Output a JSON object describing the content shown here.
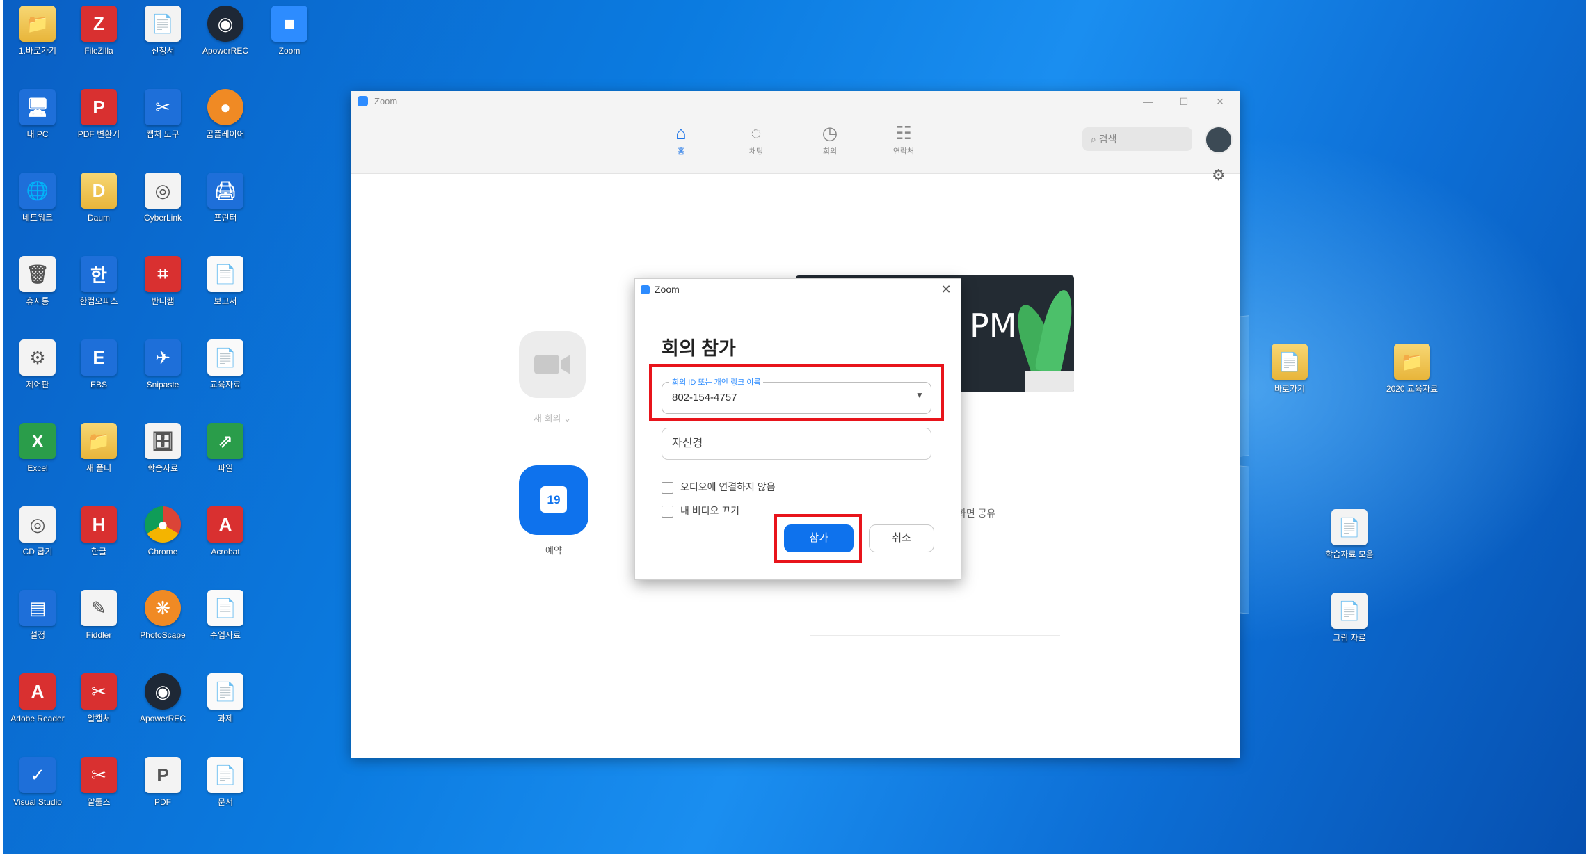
{
  "desktop": {
    "icons_left": [
      {
        "label": "1.바로가기",
        "icon": "folder-icon",
        "glyph": "📁",
        "style": "g-folder"
      },
      {
        "label": "FileZilla",
        "icon": "filezilla-icon",
        "glyph": "Z",
        "style": "g-red"
      },
      {
        "label": "신청서",
        "icon": "document-icon",
        "glyph": "📄",
        "style": "g-white"
      },
      {
        "label": "ApowerREC",
        "icon": "recorder-icon",
        "glyph": "◉",
        "style": "g-dark"
      },
      {
        "label": "Zoom",
        "icon": "zoom-icon",
        "glyph": "■",
        "style": "g-zoom"
      },
      {
        "label": "내 PC",
        "icon": "computer-icon",
        "glyph": "🖥",
        "style": "g-blue"
      },
      {
        "label": "PDF 변환기",
        "icon": "pdf-converter-icon",
        "glyph": "P",
        "style": "g-red"
      },
      {
        "label": "캡처 도구",
        "icon": "capture-icon",
        "glyph": "✂",
        "style": "g-blue"
      },
      {
        "label": "곰플레이어",
        "icon": "player-icon",
        "glyph": "●",
        "style": "g-orange"
      },
      {
        "label": "네트워크",
        "icon": "network-icon",
        "glyph": "🌐",
        "style": "g-blue"
      },
      {
        "label": "Daum",
        "icon": "daum-icon",
        "glyph": "D",
        "style": "g-folder"
      },
      {
        "label": "CyberLink",
        "icon": "disc-icon",
        "glyph": "◎",
        "style": "g-white"
      },
      {
        "label": "프린터",
        "icon": "printer-icon",
        "glyph": "🖨",
        "style": "g-blue"
      },
      {
        "label": "휴지통",
        "icon": "recycle-bin-icon",
        "glyph": "🗑",
        "style": "g-white"
      },
      {
        "label": "한컴오피스",
        "icon": "hancom-icon",
        "glyph": "한",
        "style": "g-blue"
      },
      {
        "label": "반디캠",
        "icon": "crop-icon",
        "glyph": "⌗",
        "style": "g-red"
      },
      {
        "label": "보고서",
        "icon": "document-icon",
        "glyph": "📄",
        "style": "g-doc"
      },
      {
        "label": "제어판",
        "icon": "control-panel-icon",
        "glyph": "⚙",
        "style": "g-white"
      },
      {
        "label": "EBS",
        "icon": "ebs-icon",
        "glyph": "E",
        "style": "g-blue"
      },
      {
        "label": "Snipaste",
        "icon": "snip-icon",
        "glyph": "✈",
        "style": "g-blue"
      },
      {
        "label": "교육자료",
        "icon": "document-icon",
        "glyph": "📄",
        "style": "g-doc"
      },
      {
        "label": "Excel",
        "icon": "excel-icon",
        "glyph": "X",
        "style": "g-green"
      },
      {
        "label": "새 폴더",
        "icon": "folder-icon",
        "glyph": "📁",
        "style": "g-folder"
      },
      {
        "label": "학습자료",
        "icon": "archive-icon",
        "glyph": "🗄",
        "style": "g-white"
      },
      {
        "label": "파일",
        "icon": "shortcut-icon",
        "glyph": "⇗",
        "style": "g-green"
      },
      {
        "label": "CD 굽기",
        "icon": "disc-icon",
        "glyph": "◎",
        "style": "g-white"
      },
      {
        "label": "한글",
        "icon": "hwp-icon",
        "glyph": "H",
        "style": "g-red"
      },
      {
        "label": "Chrome",
        "icon": "chrome-icon",
        "glyph": "●",
        "style": "g-chrome"
      },
      {
        "label": "Acrobat",
        "icon": "acrobat-icon",
        "glyph": "A",
        "style": "g-red"
      },
      {
        "label": "설정",
        "icon": "settings-window-icon",
        "glyph": "▤",
        "style": "g-blue"
      },
      {
        "label": "Fiddler",
        "icon": "fiddler-icon",
        "glyph": "✎",
        "style": "g-white"
      },
      {
        "label": "PhotoScape",
        "icon": "photoscape-icon",
        "glyph": "❋",
        "style": "g-orange"
      },
      {
        "label": "수업자료",
        "icon": "document-icon",
        "glyph": "📄",
        "style": "g-doc"
      },
      {
        "label": "Adobe Reader",
        "icon": "adobe-reader-icon",
        "glyph": "A",
        "style": "g-red"
      },
      {
        "label": "알캡처",
        "icon": "alcapture-icon",
        "glyph": "✂",
        "style": "g-red"
      },
      {
        "label": "ApowerREC",
        "icon": "recorder-icon",
        "glyph": "◉",
        "style": "g-dark"
      },
      {
        "label": "과제",
        "icon": "document-icon",
        "glyph": "📄",
        "style": "g-doc"
      },
      {
        "label": "Visual Studio",
        "icon": "visual-studio-icon",
        "glyph": "✓",
        "style": "g-blue"
      },
      {
        "label": "알툴즈",
        "icon": "altools-icon",
        "glyph": "✂",
        "style": "g-red"
      },
      {
        "label": "PDF",
        "icon": "pdf-file-icon",
        "glyph": "P",
        "style": "g-white"
      },
      {
        "label": "문서",
        "icon": "document-icon",
        "glyph": "📄",
        "style": "g-doc"
      }
    ],
    "icons_right": [
      {
        "label": "바로가기",
        "icon": "shortcut-file-icon",
        "glyph": "📄",
        "style": "g-folder"
      },
      {
        "label": "2020 교육자료",
        "icon": "folder-icon",
        "glyph": "📁",
        "style": "g-folder"
      },
      {
        "label": "학습자료 모음",
        "icon": "document-icon",
        "glyph": "📄",
        "style": "g-white"
      },
      {
        "label": "그림 자료",
        "icon": "document-icon",
        "glyph": "📄",
        "style": "g-white"
      }
    ]
  },
  "zoom_window": {
    "title": "Zoom",
    "nav": [
      {
        "label": "홈",
        "icon": "home-icon",
        "glyph": "⌂"
      },
      {
        "label": "채팅",
        "icon": "chat-icon",
        "glyph": "◌"
      },
      {
        "label": "회의",
        "icon": "clock-icon",
        "glyph": "◷"
      },
      {
        "label": "연락처",
        "icon": "contacts-icon",
        "glyph": "☷"
      }
    ],
    "search_placeholder": "검색",
    "new_meeting_label": "새 회의 ⌄",
    "schedule_label": "예약",
    "calendar_day": "19",
    "banner_time": "PM",
    "share_text": "화면 공유"
  },
  "join_dialog": {
    "title": "Zoom",
    "heading": "회의 참가",
    "meeting_id_label": "회의 ID 또는 개인 링크 이름",
    "meeting_id_value": "802-154-4757",
    "name_value": "자신경",
    "option_no_audio": "오디오에 연결하지 않음",
    "option_video_off": "내 비디오 끄기",
    "join_label": "참가",
    "cancel_label": "취소"
  },
  "colors": {
    "accent": "#0e72ed",
    "highlight": "#e8141b"
  }
}
